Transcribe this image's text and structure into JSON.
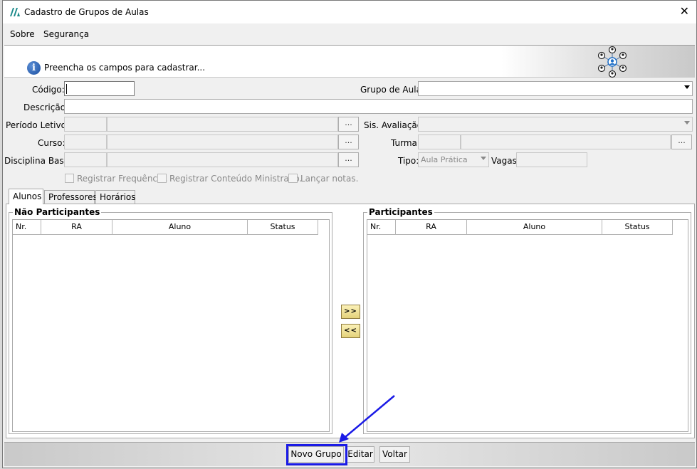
{
  "window": {
    "title": "Cadastro de Grupos de Aulas",
    "close_glyph": "✕"
  },
  "menu": {
    "items": [
      "Sobre",
      "Segurança"
    ]
  },
  "banner": {
    "message": "Preencha os campos para cadastrar...",
    "info_glyph": "i"
  },
  "form": {
    "codigo_label": "Código:",
    "grupo_aula_label": "Grupo de Aula:",
    "descricao_label": "Descrição:",
    "periodo_letivo_label": "Período Letivo:",
    "sis_avaliacao_label": "Sis. Avaliação:",
    "curso_label": "Curso:",
    "turma_label": "Turma:",
    "disciplina_base_label": "Disciplina Base:",
    "tipo_label": "Tipo:",
    "tipo_value": "Aula Prática",
    "vagas_label": "Vagas:",
    "ellipsis": "...",
    "checkboxes": [
      "Registrar Frequência.",
      "Registrar Conteúdo Ministrado.",
      "Lançar notas."
    ]
  },
  "tabs": [
    "Alunos",
    "Professores",
    "Horários"
  ],
  "lists": {
    "left_title": "Não Participantes",
    "right_title": "Participantes",
    "columns": [
      "Nr.",
      "RA",
      "Aluno",
      "Status"
    ],
    "add_label": ">>",
    "remove_label": "<<"
  },
  "footer": {
    "buttons": [
      "Novo Grupo",
      "Editar",
      "Voltar"
    ]
  },
  "colors": {
    "highlight": "#1a1ae6",
    "arrow": "#1a1ae6",
    "move_button": "#efe08f"
  }
}
